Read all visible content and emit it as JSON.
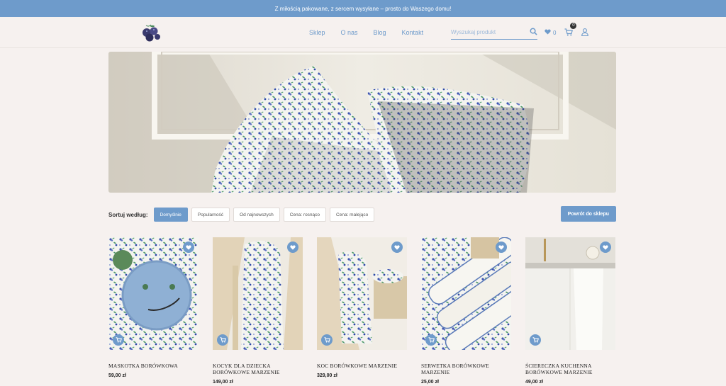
{
  "topbar": {
    "text": "Z miłością pakowane, z sercem wysyłane – prosto do Waszego domu!"
  },
  "nav": [
    "Sklep",
    "O nas",
    "Blog",
    "Kontakt"
  ],
  "search": {
    "placeholder": "Wyszukaj produkt"
  },
  "wishlist": {
    "count": "0"
  },
  "cart": {
    "count": "0"
  },
  "sort": {
    "label": "Sortuj według:",
    "options": [
      "Domyślnie",
      "Popularność",
      "Od najnowszych",
      "Cena: rosnąco",
      "Cena: malejąco"
    ],
    "active": "Domyślnie"
  },
  "back_button": "Powrót do sklepu",
  "products": [
    {
      "name": "MASKOTKA BORÓWKOWA",
      "price": "59,00 zł"
    },
    {
      "name": "KOCYK DLA DZIECKA BORÓWKOWE MARZENIE",
      "price": "149,00 zł"
    },
    {
      "name": "KOC BORÓWKOWE MARZENIE",
      "price": "329,00 zł"
    },
    {
      "name": "SERWETKA BORÓWKOWE MARZENIE",
      "price": "25,00 zł"
    },
    {
      "name": "ŚCIERECZKA KUCHENNA BORÓWKOWE MARZENIE",
      "price": "49,00 zł"
    }
  ],
  "colors": {
    "accent": "#6e9bcb",
    "background": "#f6f1ef"
  }
}
